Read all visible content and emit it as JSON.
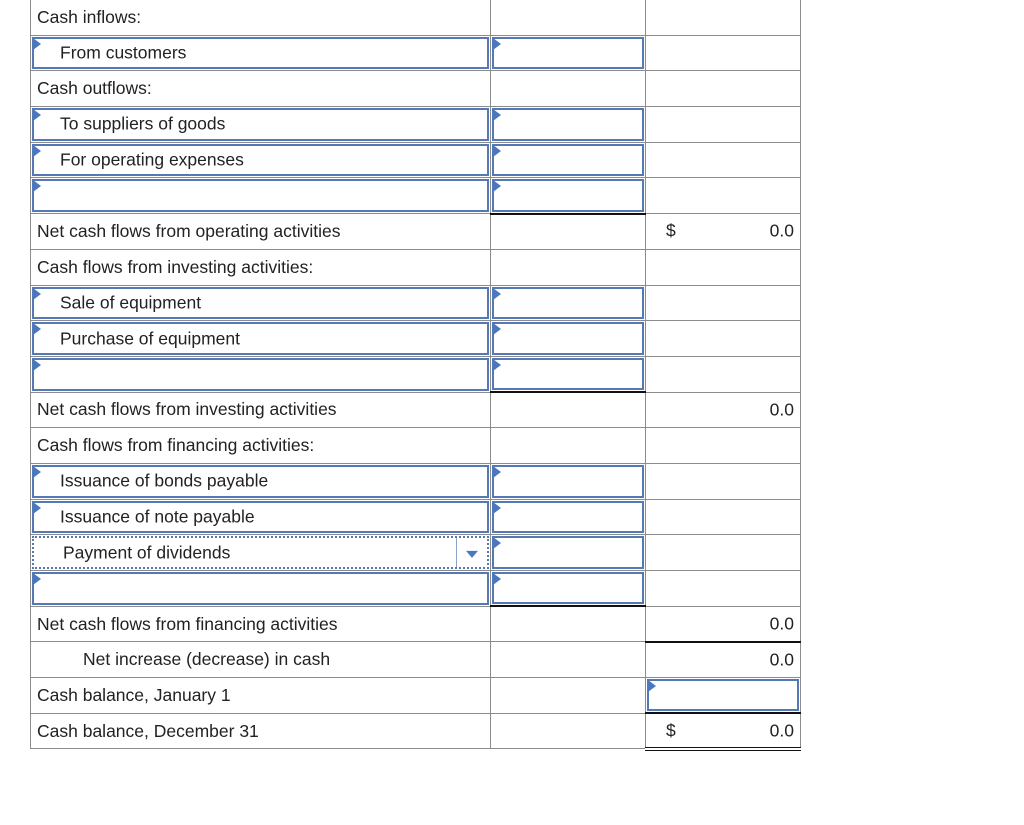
{
  "statement": {
    "rows": [
      {
        "label": "Cash inflows:",
        "kind": "header"
      },
      {
        "label": "From customers",
        "kind": "input-line",
        "amount": ""
      },
      {
        "label": "Cash outflows:",
        "kind": "header"
      },
      {
        "label": "To suppliers of goods",
        "kind": "input-line",
        "amount": ""
      },
      {
        "label": "For operating expenses",
        "kind": "input-line",
        "amount": ""
      },
      {
        "label": "",
        "kind": "input-line",
        "amount": ""
      },
      {
        "label": "Net cash flows from operating activities",
        "kind": "total",
        "currency": "$",
        "total": "0.0"
      },
      {
        "label": "Cash flows from investing activities:",
        "kind": "header"
      },
      {
        "label": "Sale of equipment",
        "kind": "input-line",
        "amount": ""
      },
      {
        "label": "Purchase of equipment",
        "kind": "input-line",
        "amount": ""
      },
      {
        "label": "",
        "kind": "input-line",
        "amount": ""
      },
      {
        "label": "Net cash flows from investing activities",
        "kind": "total",
        "total": "0.0"
      },
      {
        "label": "Cash flows from financing activities:",
        "kind": "header"
      },
      {
        "label": "Issuance of bonds payable",
        "kind": "input-line",
        "amount": ""
      },
      {
        "label": "Issuance of note payable",
        "kind": "input-line",
        "amount": ""
      },
      {
        "label": "Payment of dividends",
        "kind": "dropdown-line",
        "amount": ""
      },
      {
        "label": "",
        "kind": "input-line",
        "amount": ""
      },
      {
        "label": "Net cash flows from financing activities",
        "kind": "total",
        "total": "0.0"
      },
      {
        "label": "Net increase (decrease) in cash",
        "kind": "total",
        "total": "0.0"
      },
      {
        "label": "Cash balance, January 1",
        "kind": "input-total",
        "total": ""
      },
      {
        "label": "Cash balance, December 31",
        "kind": "total",
        "currency": "$",
        "total": "0.0"
      }
    ]
  },
  "icons": {
    "input_flag": "triangle-right",
    "dropdown": "caret-down"
  },
  "colors": {
    "input_border": "#5479b4",
    "flag": "#4a78c0",
    "grid": "#8c8c8c"
  }
}
